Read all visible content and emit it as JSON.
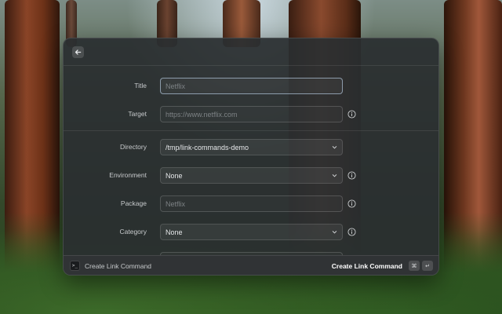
{
  "window": {
    "title": "Create Link Command"
  },
  "form": {
    "title": {
      "label": "Title",
      "placeholder": "Netflix"
    },
    "target": {
      "label": "Target",
      "placeholder": "https://www.netflix.com"
    },
    "directory": {
      "label": "Directory",
      "value": "/tmp/link-commands-demo"
    },
    "environment": {
      "label": "Environment",
      "value": "None"
    },
    "package": {
      "label": "Package",
      "placeholder": "Netflix"
    },
    "category": {
      "label": "Category",
      "value": "None"
    }
  },
  "footer": {
    "title": "Create Link Command",
    "primary_action": "Create Link Command",
    "shortcut_modifier": "⌘",
    "shortcut_key": "↵",
    "terminal_glyph": ">_"
  },
  "icons": {
    "back": "arrow-left-icon",
    "info": "info-circle-icon",
    "chevron": "chevron-down-icon",
    "terminal": "terminal-icon"
  }
}
